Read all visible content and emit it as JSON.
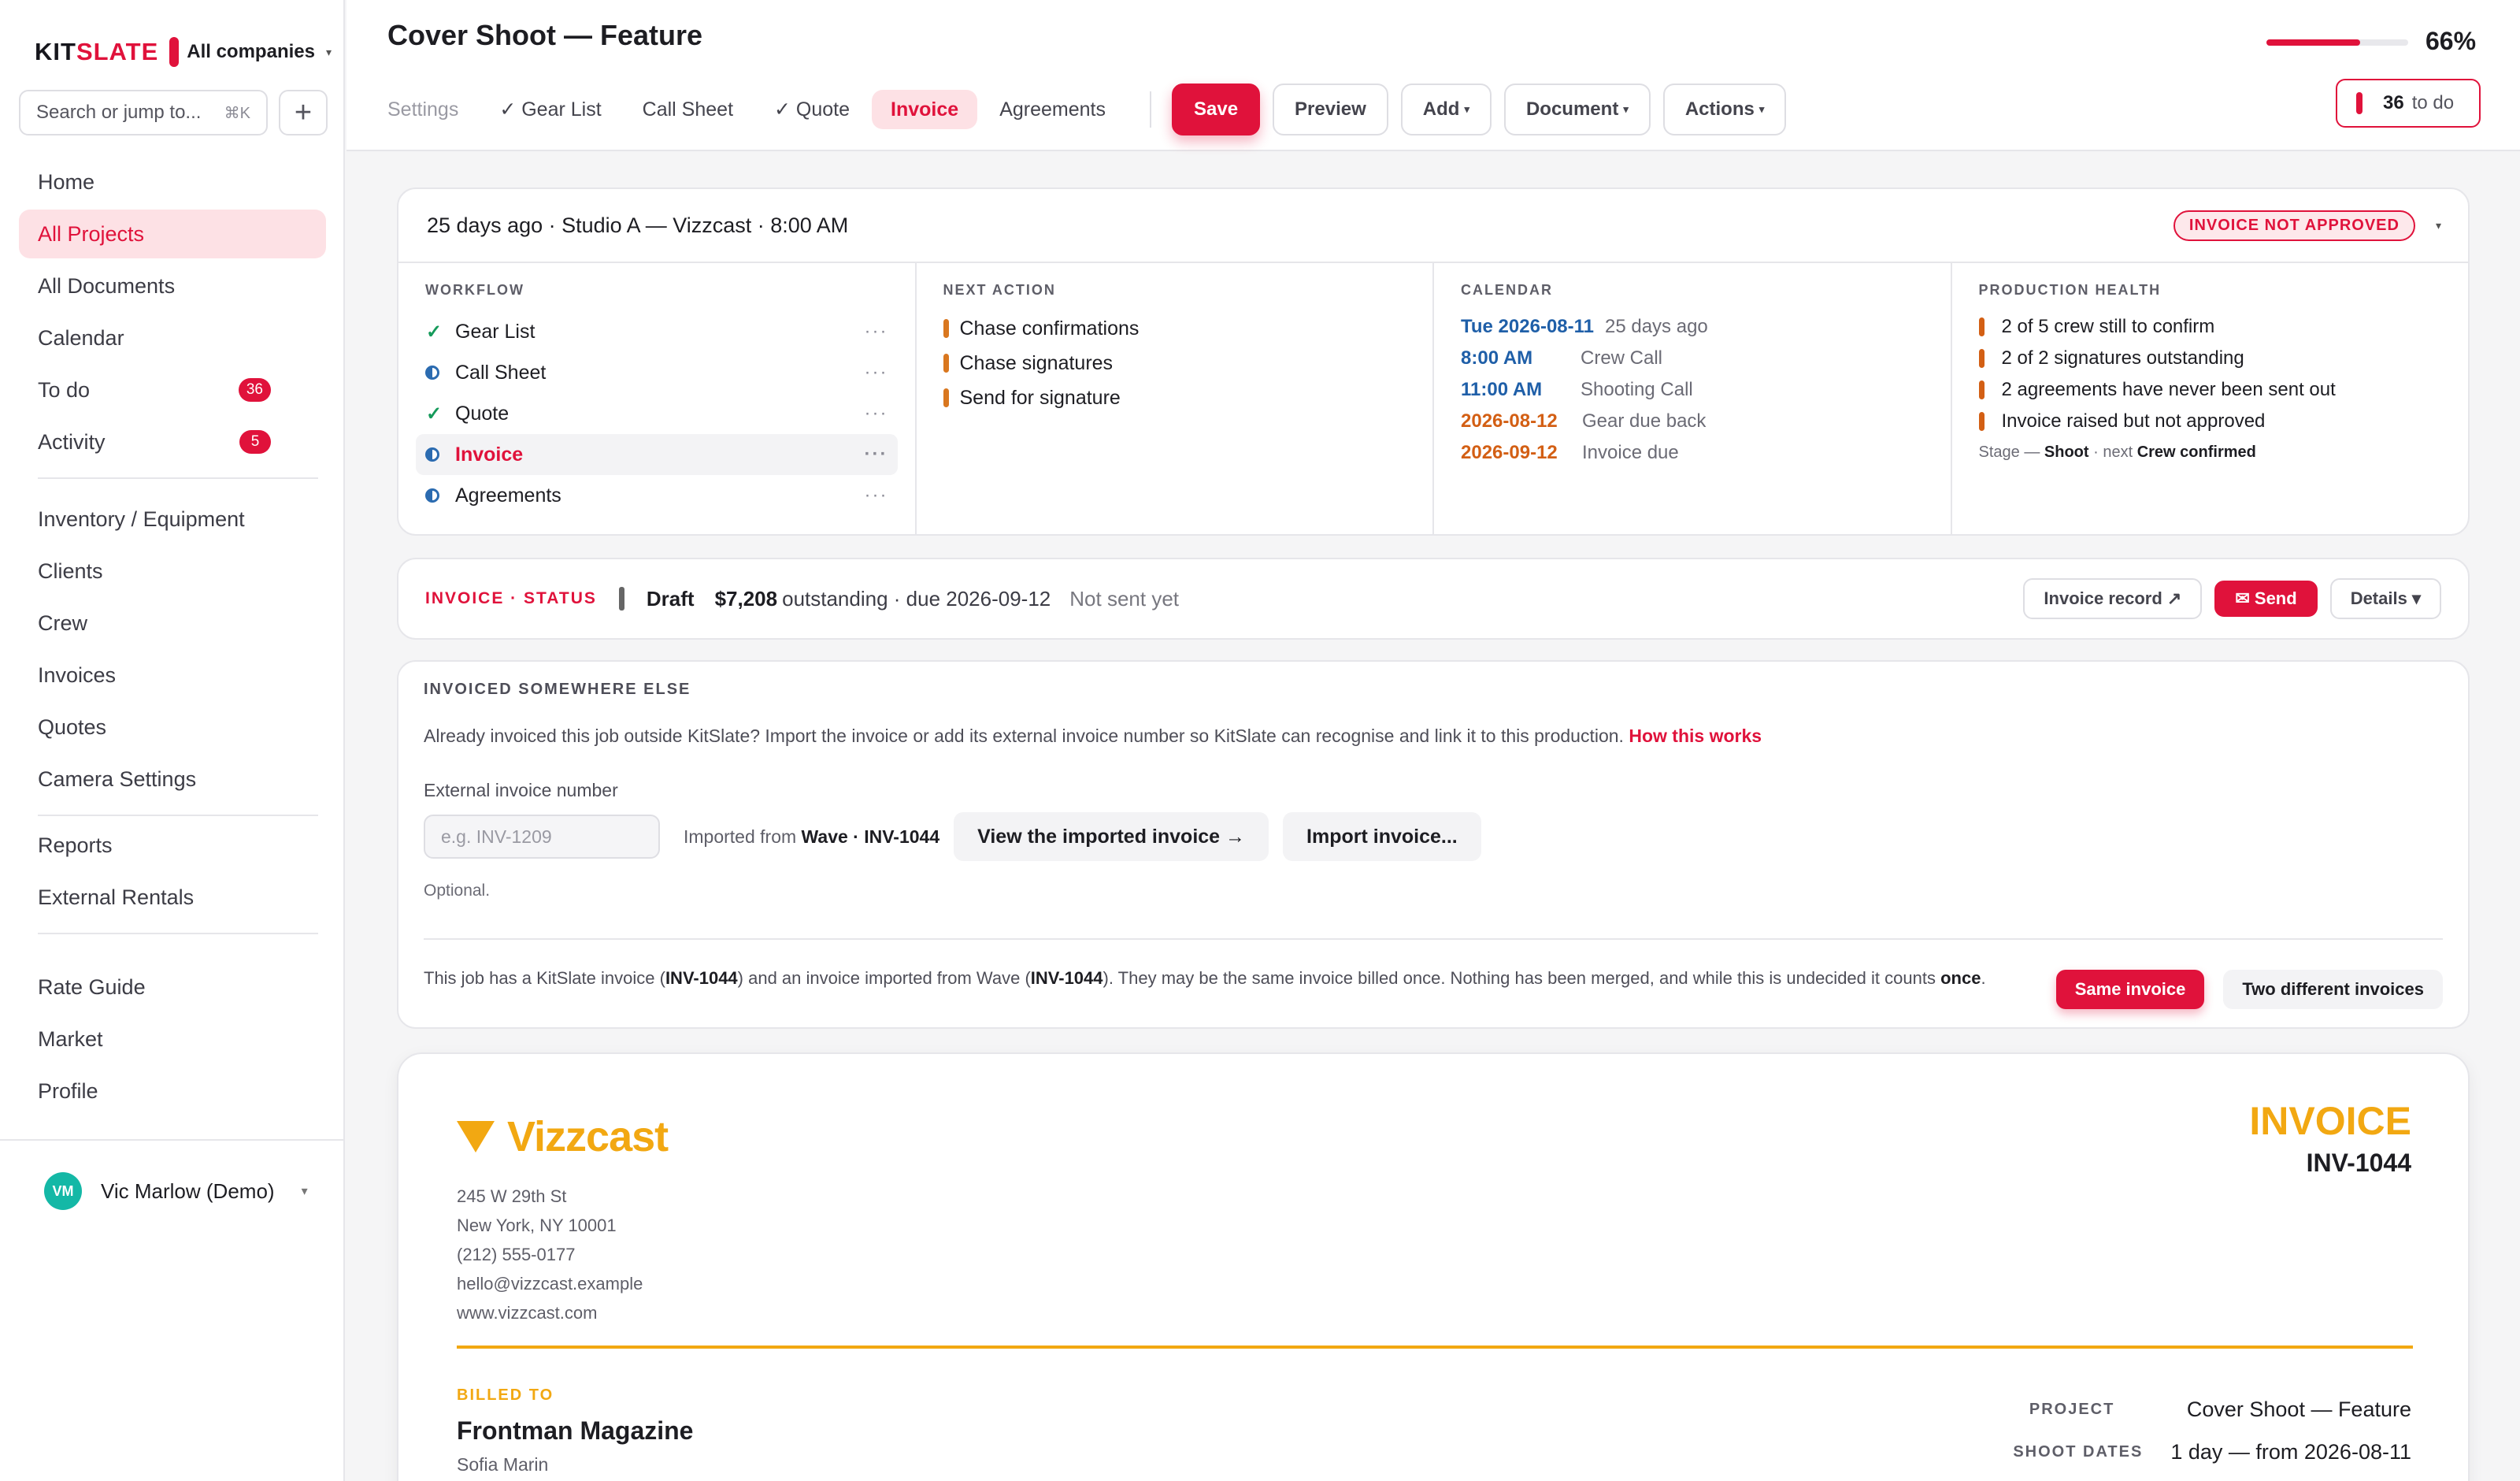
{
  "brand": {
    "kit": "KIT",
    "slate": "SLATE",
    "company": "All companies"
  },
  "search": {
    "placeholder": "Search or jump to...",
    "shortcut": "⌘K",
    "add": "+"
  },
  "nav_groups": [
    [
      {
        "label": "Home"
      },
      {
        "label": "All Projects",
        "active": true
      },
      {
        "label": "All Documents"
      },
      {
        "label": "Calendar"
      },
      {
        "label": "To do",
        "badge": "36"
      },
      {
        "label": "Activity",
        "badge": "5"
      }
    ],
    [
      {
        "label": "Inventory / Equipment"
      },
      {
        "label": "Clients"
      },
      {
        "label": "Crew"
      },
      {
        "label": "Invoices"
      },
      {
        "label": "Quotes"
      },
      {
        "label": "Camera Settings"
      }
    ],
    [
      {
        "label": "Reports"
      },
      {
        "label": "External Rentals"
      }
    ],
    [
      {
        "label": "Rate Guide"
      },
      {
        "label": "Market"
      },
      {
        "label": "Profile"
      }
    ]
  ],
  "user": {
    "initials": "VM",
    "name": "Vic Marlow (Demo)"
  },
  "header": {
    "title": "Cover Shoot — Feature",
    "progress_value": 66,
    "progress_label": "66%",
    "tabs": [
      {
        "label": "Settings",
        "muted": true
      },
      {
        "label": "✓ Gear List"
      },
      {
        "label": "Call Sheet"
      },
      {
        "label": "✓ Quote"
      },
      {
        "label": "Invoice",
        "active": true
      },
      {
        "label": "Agreements"
      }
    ],
    "save": "Save",
    "preview": "Preview",
    "add": "Add",
    "document": "Document",
    "actions": "Actions",
    "todo_count": "36",
    "todo_label": "to do"
  },
  "overview": {
    "meta": "25 days ago · Studio A — Vizzcast · 8:00 AM",
    "status_pill": "INVOICE NOT APPROVED",
    "workflow_title": "WORKFLOW",
    "workflow": [
      {
        "label": "Gear List",
        "state": "done"
      },
      {
        "label": "Call Sheet",
        "state": "partial"
      },
      {
        "label": "Quote",
        "state": "done"
      },
      {
        "label": "Invoice",
        "state": "partial",
        "active": true
      },
      {
        "label": "Agreements",
        "state": "partial"
      }
    ],
    "next_title": "NEXT ACTION",
    "next": [
      "Chase confirmations",
      "Chase signatures",
      "Send for signature"
    ],
    "calendar_title": "CALENDAR",
    "calendar": [
      {
        "date": "Tue 2026-08-11",
        "text": "25 days ago",
        "tone": "blue"
      },
      {
        "date": "8:00 AM",
        "text": "Crew Call",
        "tone": "blue"
      },
      {
        "date": "11:00 AM",
        "text": "Shooting Call",
        "tone": "blue"
      },
      {
        "date": "2026-08-12",
        "text": "Gear due back",
        "tone": "orange"
      },
      {
        "date": "2026-09-12",
        "text": "Invoice due",
        "tone": "orange"
      }
    ],
    "health_title": "PRODUCTION HEALTH",
    "health": [
      "2 of 5 crew still to confirm",
      "2 of 2 signatures outstanding",
      "2 agreements have never been sent out",
      "Invoice raised but not approved"
    ],
    "stage_prefix": "Stage —",
    "stage": "Shoot",
    "stage_next_prefix": "· next",
    "stage_next": "Crew confirmed"
  },
  "invoice_status": {
    "label": "INVOICE · STATUS",
    "state": "Draft",
    "amount": "$7,208",
    "detail": "outstanding · due 2026-09-12",
    "sent": "Not sent yet",
    "record": "Invoice record ↗",
    "send": "✉ Send",
    "details": "Details ▾"
  },
  "external": {
    "title": "INVOICED SOMEWHERE ELSE",
    "desc": "Already invoiced this job outside KitSlate? Import the invoice or add its external invoice number so KitSlate can recognise and link it to this production.",
    "link": "How this works",
    "field_label": "External invoice number",
    "field_placeholder": "e.g. INV-1209",
    "imported_prefix": "Imported from",
    "imported_source": "Wave · INV-1044",
    "view_btn": "View the imported invoice →",
    "import_btn": "Import invoice...",
    "optional": "Optional.",
    "dup_1": "This job has a KitSlate invoice (",
    "dup_inv1": "INV-1044",
    "dup_2": ") and an invoice imported from Wave (",
    "dup_inv2": "INV-1044",
    "dup_3": "). They may be the same invoice billed once. Nothing has been merged, and while this is undecided it counts",
    "dup_once": "once",
    "dup_4": ".",
    "same_btn": "Same invoice",
    "diff_btn": "Two different invoices"
  },
  "invoice_doc": {
    "company": "Vizzcast",
    "address": [
      "245 W 29th St",
      "New York, NY 10001",
      "(212) 555-0177",
      "hello@vizzcast.example",
      "www.vizzcast.com"
    ],
    "word": "INVOICE",
    "number": "INV-1044",
    "billed_label": "BILLED TO",
    "billed_name": "Frontman Magazine",
    "billed_contact": "Sofia Marin",
    "project_label": "PROJECT",
    "project": "Cover Shoot — Feature",
    "dates_label": "SHOOT DATES",
    "dates": "1 day — from 2026-08-11"
  },
  "colors": {
    "accent": "#e0123b",
    "brand_gold": "#f2a812",
    "done_green": "#159a5a",
    "warn_orange": "#d35f14"
  }
}
